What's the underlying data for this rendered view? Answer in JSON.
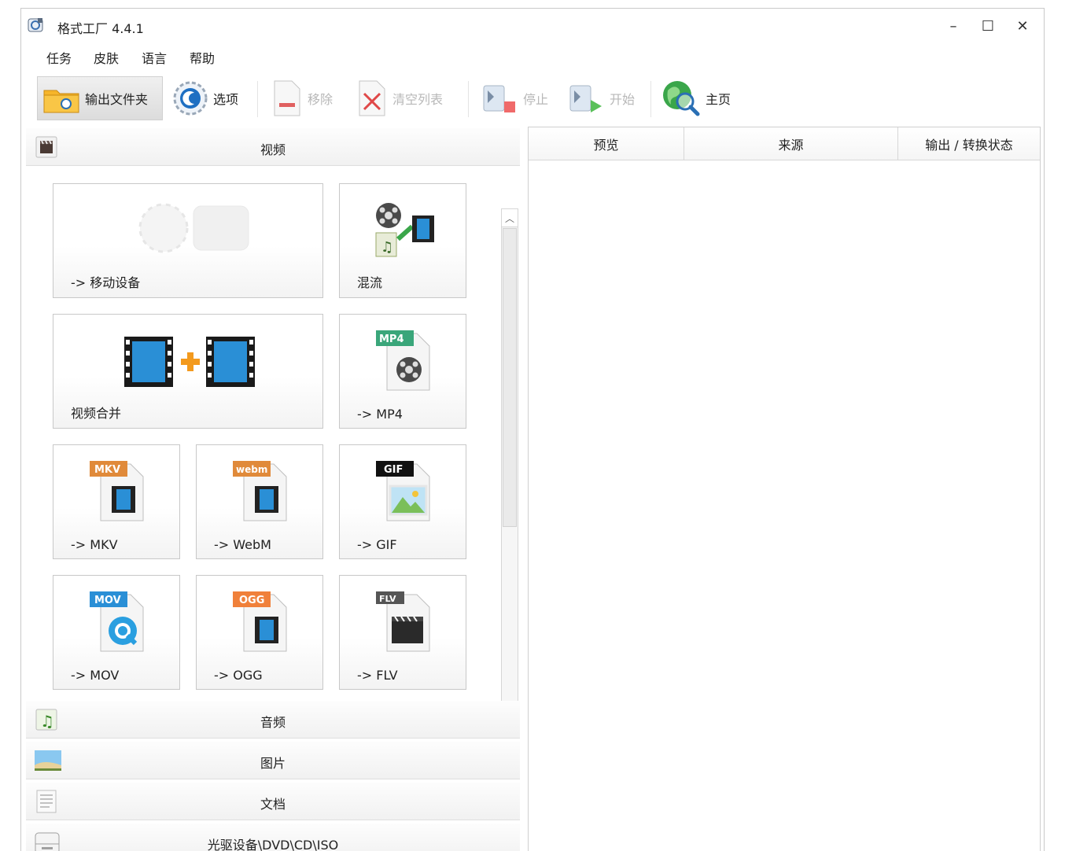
{
  "window": {
    "title": "格式工厂 4.4.1",
    "minimize": "–",
    "maximize": "☐",
    "close": "✕"
  },
  "menu": [
    "任务",
    "皮肤",
    "语言",
    "帮助"
  ],
  "toolbar": {
    "output_folder": "输出文件夹",
    "options": "选项",
    "remove": "移除",
    "clear_list": "清空列表",
    "stop": "停止",
    "start": "开始",
    "home": "主页"
  },
  "categories": {
    "video": "视频",
    "audio": "音频",
    "image": "图片",
    "document": "文档",
    "disc": "光驱设备\\DVD\\CD\\ISO"
  },
  "video_tiles": {
    "mobile": "-> 移动设备",
    "mux": "混流",
    "join": "视频合并",
    "mp4": "-> MP4",
    "mkv": "-> MKV",
    "webm": "-> WebM",
    "gif": "-> GIF",
    "mov": "-> MOV",
    "ogg": "-> OGG",
    "flv": "-> FLV"
  },
  "file_badges": {
    "mp4": "MP4",
    "mkv": "MKV",
    "webm": "webm",
    "gif": "GIF",
    "mov": "MOV",
    "ogg": "OGG",
    "flv": "FLV"
  },
  "task_columns": [
    "预览",
    "来源",
    "输出 / 转换状态"
  ],
  "colors": {
    "accent_blue": "#1e88c9",
    "film_blue": "#2a8fd6",
    "orange": "#f39a1e",
    "green": "#3aa64a"
  }
}
